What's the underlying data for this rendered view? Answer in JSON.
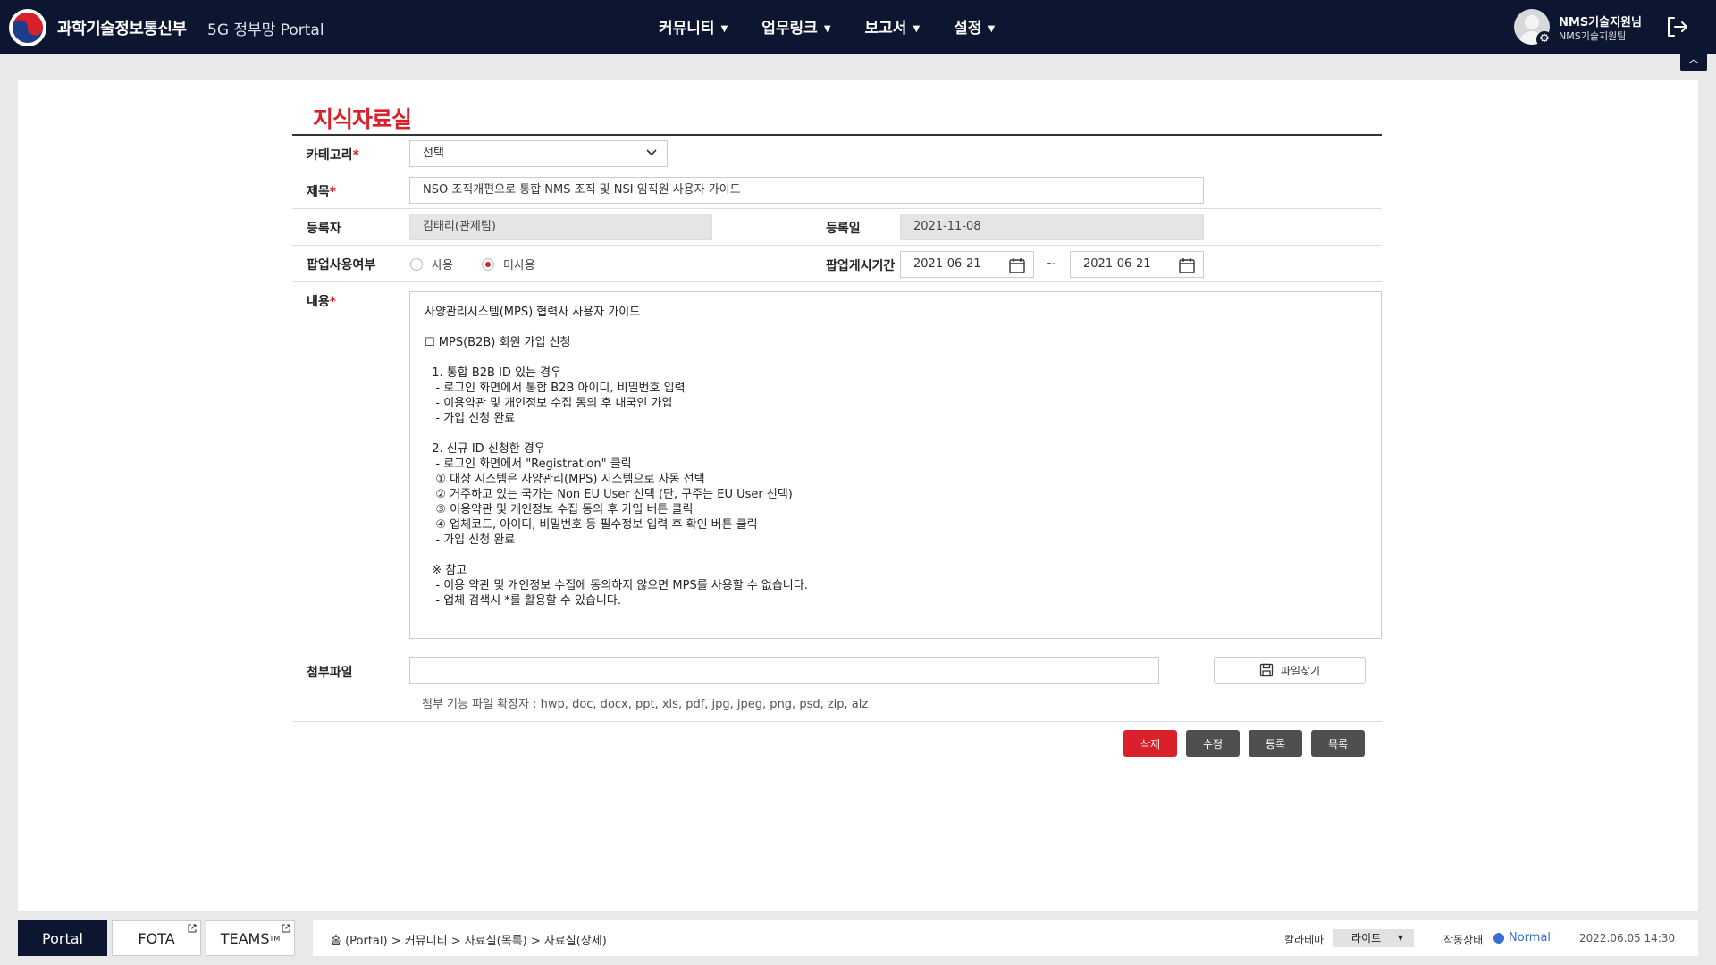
{
  "header": {
    "org_name": "과학기술정보통신부",
    "portal_name": "5G 정부망 Portal",
    "nav": [
      {
        "label": "커뮤니티"
      },
      {
        "label": "업무링크"
      },
      {
        "label": "보고서"
      },
      {
        "label": "설정"
      }
    ],
    "user_name": "NMS기술지원님",
    "user_team": "NMS기술지원팀"
  },
  "page": {
    "title": "지식자료실"
  },
  "form": {
    "category_label": "카테고리",
    "category_value": "선택",
    "subject_label": "제목",
    "subject_value": "NSO 조직개편으로 통합 NMS 조직 및 NSI 임직원 사용자 가이드",
    "author_label": "등록자",
    "author_value": "김태리(관제팀)",
    "date_label": "등록일",
    "date_value": "2021-11-08",
    "popup_label": "팝업사용여부",
    "popup_use": "사용",
    "popup_nouse": "미사용",
    "popup_selected": "미사용",
    "period_label": "팝업게시기간",
    "period_start": "2021-06-21",
    "period_sep": "~",
    "period_end": "2021-06-21",
    "content_label": "내용",
    "content_value": "사양관리시스템(MPS) 협력사 사용자 가이드\n\n☐ MPS(B2B) 회원 가입 신청\n\n  1. 통합 B2B ID 있는 경우\n   - 로그인 화면에서 통합 B2B 아이디, 비밀번호 입력\n   - 이용약관 및 개인정보 수집 동의 후 내국인 가입\n   - 가입 신청 완료\n\n  2. 신규 ID 신청한 경우\n   - 로그인 화면에서 \"Registration\" 클릭\n   ① 대상 시스템은 사양관리(MPS) 시스템으로 자동 선택\n   ② 거주하고 있는 국가는 Non EU User 선택 (단, 구주는 EU User 선택)\n   ③ 이용약관 및 개인정보 수집 동의 후 가입 버튼 클릭\n   ④ 업체코드, 아이디, 비밀번호 등 필수정보 입력 후 확인 버튼 클릭\n   - 가입 신청 완료\n\n  ※ 참고\n   - 이용 약관 및 개인정보 수집에 동의하지 않으면 MPS를 사용할 수 없습니다.\n   - 업체 검색시 *를 활용할 수 있습니다.",
    "attachment_label": "첨부파일",
    "file_button": "파일찾기",
    "file_ext_note": "첨부 기능 파일 확장자 : hwp, doc, docx, ppt, xls, pdf, jpg, jpeg, png, psd, zip, alz"
  },
  "actions": {
    "delete": "삭제",
    "edit": "수정",
    "register": "등록",
    "list": "목록"
  },
  "footer": {
    "tabs": [
      {
        "label": "Portal",
        "active": true
      },
      {
        "label": "FOTA",
        "active": false
      },
      {
        "label": "TEAMS",
        "active": false
      }
    ],
    "teams_mark": "TM",
    "breadcrumb": "홈 (Portal)  > 커뮤니티 > 자료실(목록) > 자료실(상세)",
    "theme_label": "칼라테마",
    "theme_value": "라이트",
    "status_label": "작동상태",
    "status_value": "Normal",
    "datetime": "2022.06.05 14:30"
  },
  "colors": {
    "header_bg": "#0d1630",
    "accent_red": "#d9202b",
    "status_blue": "#3a6fd0"
  },
  "icons": [
    "gov-emblem-icon",
    "caret-down-icon",
    "settings-gear-icon",
    "logout-icon",
    "chevron-up-icon",
    "chevron-down-icon",
    "calendar-icon",
    "save-file-icon",
    "external-link-icon"
  ]
}
